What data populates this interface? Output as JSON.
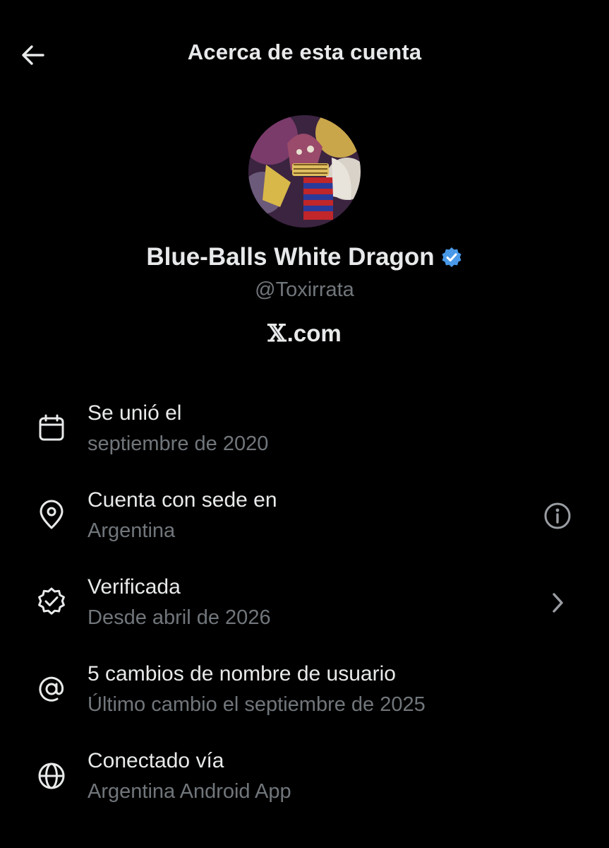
{
  "header": {
    "title": "Acerca de esta cuenta",
    "back_icon": "arrow-left-icon"
  },
  "profile": {
    "avatar_icon": "profile-avatar",
    "display_name": "Blue-Balls White Dragon",
    "verified_badge_icon": "verified-badge-icon",
    "verified_color": "#4a99e9",
    "handle": "@Toxirrata",
    "brand_prefix": "𝕏",
    "brand_suffix": ".com"
  },
  "details": [
    {
      "icon": "calendar-icon",
      "title": "Se unió el",
      "subtitle": "septiembre de 2020"
    },
    {
      "icon": "location-pin-icon",
      "title": "Cuenta con sede en",
      "subtitle": "Argentina",
      "action_icon": "info-icon"
    },
    {
      "icon": "verified-check-icon",
      "title": "Verificada",
      "subtitle": "Desde abril de 2026",
      "action_icon": "chevron-right-icon"
    },
    {
      "icon": "at-sign-icon",
      "title": "5 cambios de nombre de usuario",
      "subtitle": "Último cambio el septiembre de 2025"
    },
    {
      "icon": "globe-icon",
      "title": "Conectado vía",
      "subtitle": "Argentina Android App"
    }
  ],
  "colors": {
    "background": "#000000",
    "primary_text": "#e7e9ea",
    "secondary_text": "#71767b"
  }
}
